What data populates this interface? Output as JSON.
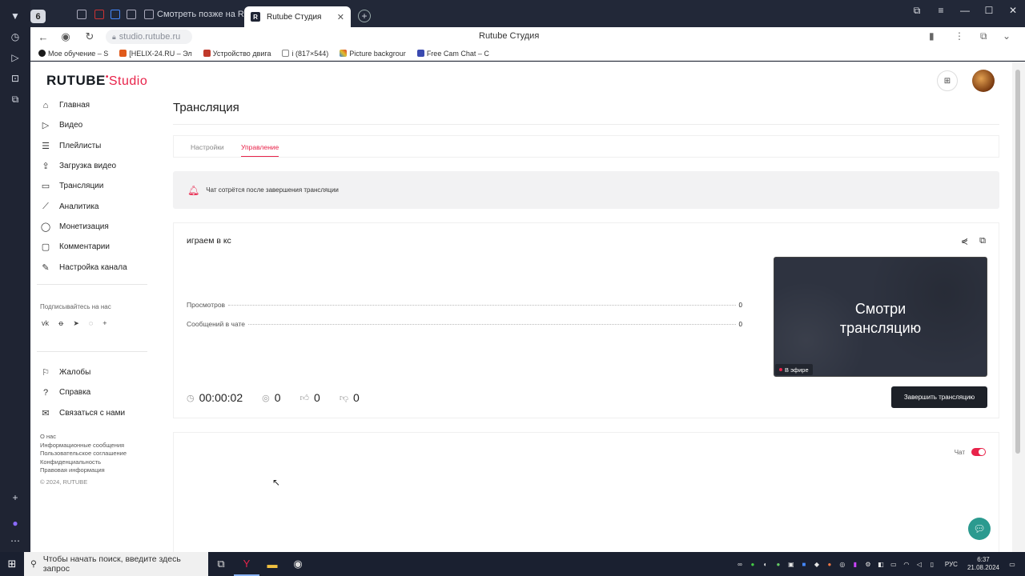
{
  "browser": {
    "tab_count": "6",
    "tabs": [
      {
        "label": "Смотреть позже на RUTU"
      },
      {
        "label": "Rutube Студия"
      }
    ],
    "url": "studio.rutube.ru",
    "page_title": "Rutube Студия",
    "bookmarks": [
      {
        "label": "Мое обучение – S",
        "color": "#1a1a1a"
      },
      {
        "label": "[HELIX-24.RU – Эл",
        "color": "#e05a1b"
      },
      {
        "label": "Устройство двига",
        "color": "#c0392b"
      },
      {
        "label": "i (817×544)",
        "color": "#888888"
      },
      {
        "label": "Picture backgrour",
        "color": "#2b7de0"
      },
      {
        "label": "Free Cam Chat – C",
        "color": "#3a4ab0"
      }
    ]
  },
  "app": {
    "logo_main": "RUTUBE",
    "logo_studio": "Studio",
    "sidebar": {
      "items": [
        {
          "label": "Главная",
          "icon": "home-icon"
        },
        {
          "label": "Видео",
          "icon": "video-icon"
        },
        {
          "label": "Плейлисты",
          "icon": "playlist-icon"
        },
        {
          "label": "Загрузка видео",
          "icon": "upload-icon"
        },
        {
          "label": "Трансляции",
          "icon": "broadcast-icon"
        },
        {
          "label": "Аналитика",
          "icon": "analytics-icon"
        },
        {
          "label": "Монетизация",
          "icon": "monetization-icon"
        },
        {
          "label": "Комментарии",
          "icon": "comments-icon"
        },
        {
          "label": "Настройка канала",
          "icon": "channel-settings-icon"
        }
      ],
      "subscribe_label": "Подписывайтесь на нас",
      "social": [
        "vk",
        "ok",
        "tg",
        "vb",
        "+"
      ],
      "secondary": [
        {
          "label": "Жалобы",
          "icon": "flag-icon"
        },
        {
          "label": "Справка",
          "icon": "help-icon"
        },
        {
          "label": "Связаться с нами",
          "icon": "mail-icon"
        }
      ],
      "footer": [
        "О нас",
        "Информационные сообщения",
        "Пользовательское соглашение",
        "Конфиденциальность",
        "Правовая информация"
      ],
      "copyright": "© 2024, RUTUBE"
    },
    "page_title": "Трансляция",
    "tabs": [
      {
        "label": "Настройки",
        "active": false
      },
      {
        "label": "Управление",
        "active": true
      }
    ],
    "notice": "Чат сотрётся после завершения трансляции",
    "stream": {
      "title": "играем в кс",
      "stats": [
        {
          "label": "Просмотров",
          "value": "0"
        },
        {
          "label": "Сообщений в чате",
          "value": "0"
        }
      ],
      "duration": "00:00:02",
      "viewers": "0",
      "likes": "0",
      "dislikes": "0",
      "preview_text_1": "Смотри",
      "preview_text_2": "трансляцию",
      "live_label": "В эфире",
      "end_button": "Завершить трансляцию"
    },
    "chat_label": "Чат",
    "chat_enabled": true
  },
  "taskbar": {
    "search_placeholder": "Чтобы начать поиск, введите здесь запрос",
    "lang": "РУС",
    "time": "6:37",
    "date": "21.08.2024"
  },
  "colors": {
    "accent": "#e8234a",
    "dark_button": "#1d2128",
    "support": "#2b9a8f"
  }
}
